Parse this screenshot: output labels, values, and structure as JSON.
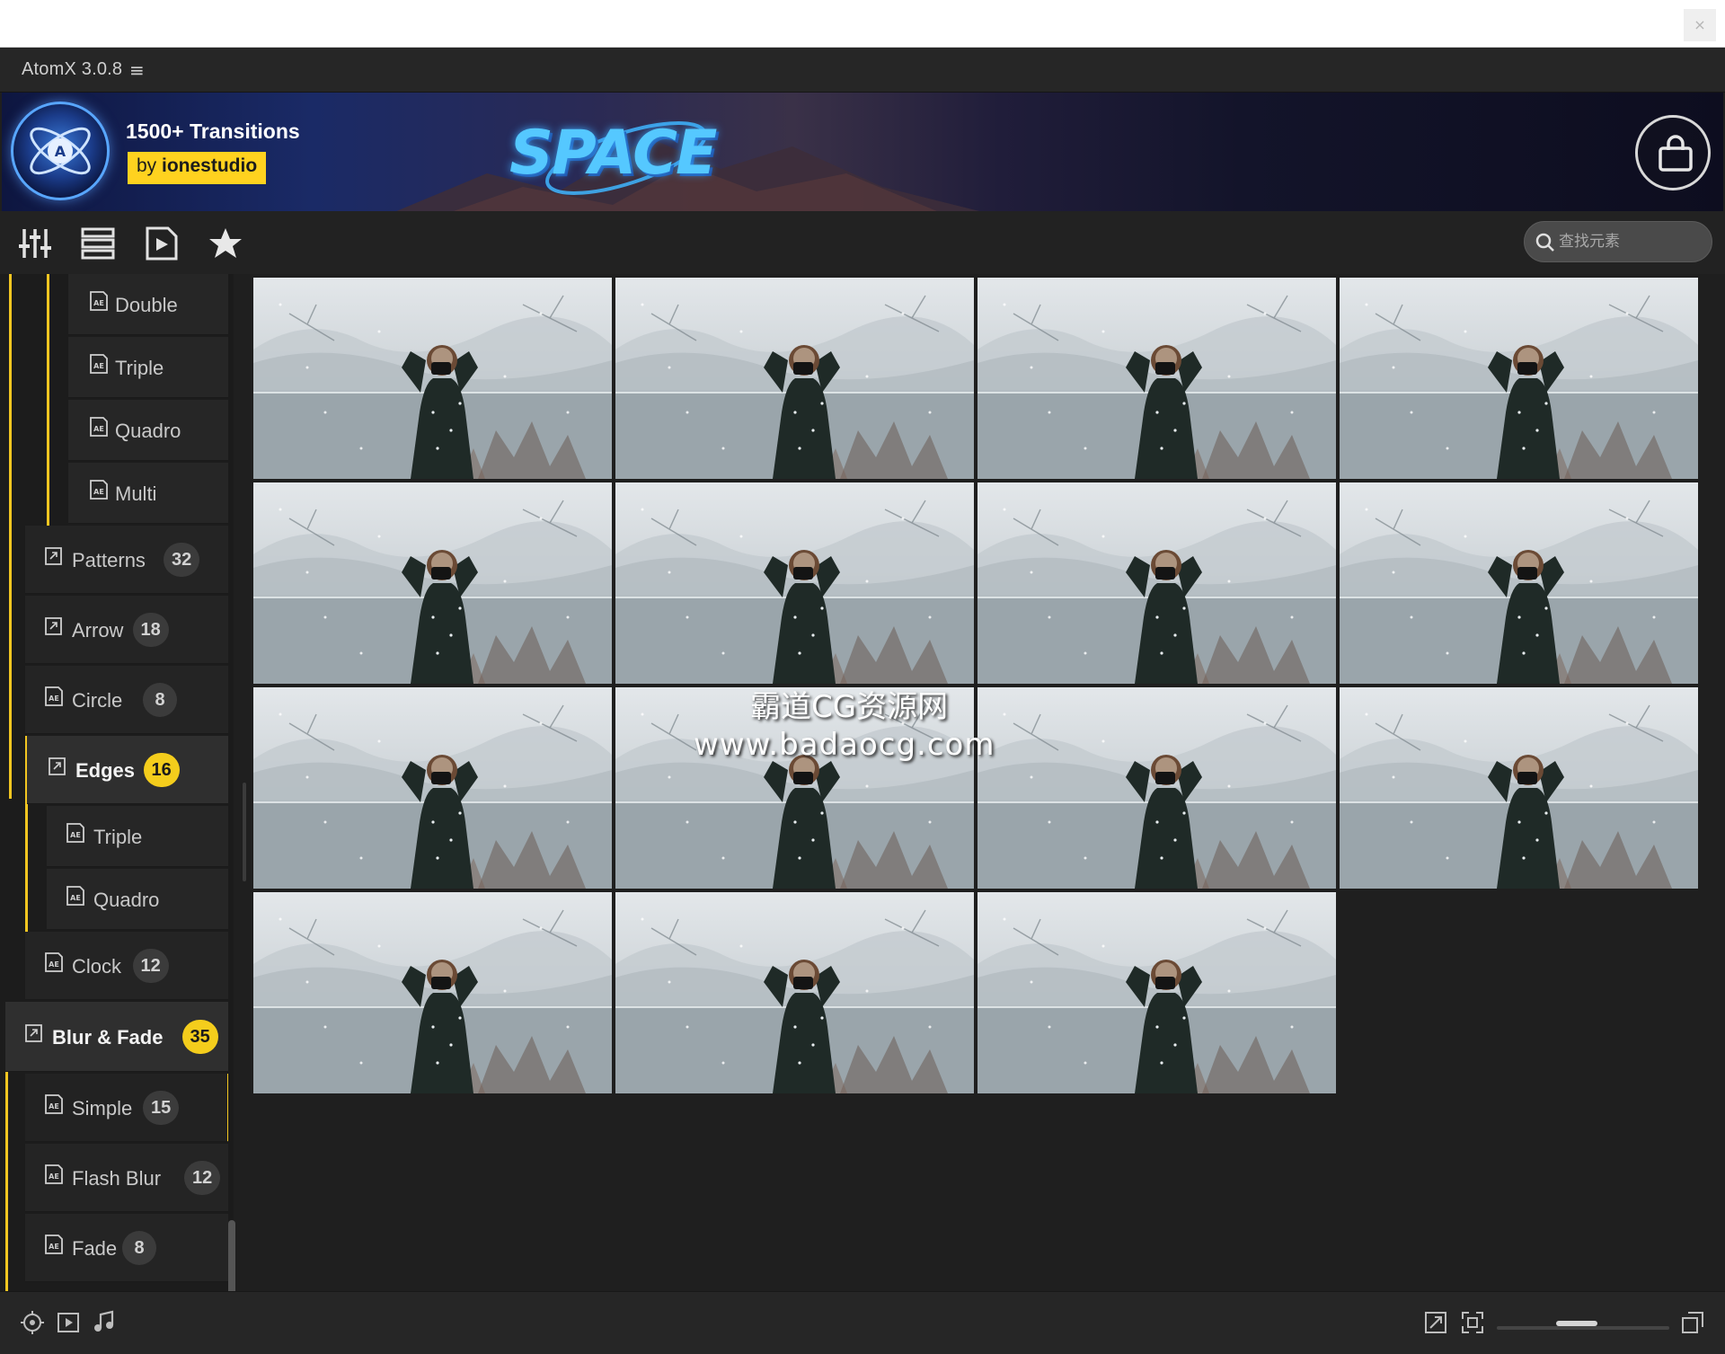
{
  "window": {
    "close_label": "×"
  },
  "app": {
    "title": "AtomX 3.0.8",
    "menu_glyph": "≡"
  },
  "banner": {
    "headline": "1500+ Transitions",
    "by_prefix": "by ",
    "by_brand": "ionestudio",
    "promo_text": "SPACE"
  },
  "toolbar": {
    "icons": [
      "sliders-icon",
      "list-view-icon",
      "play-file-icon",
      "star-icon"
    ],
    "search": {
      "placeholder": "查找元素",
      "value": ""
    }
  },
  "sidebar": {
    "items": [
      {
        "label": "Double",
        "level": 3,
        "badge": ""
      },
      {
        "label": "Triple",
        "level": 3,
        "badge": ""
      },
      {
        "label": "Quadro",
        "level": 3,
        "badge": ""
      },
      {
        "label": "Multi",
        "level": 3,
        "badge": ""
      },
      {
        "label": "Patterns",
        "level": 2,
        "badge": "32"
      },
      {
        "label": "Arrow",
        "level": 2,
        "badge": "18"
      },
      {
        "label": "Circle",
        "level": 2,
        "badge": "8"
      },
      {
        "label": "Edges",
        "level": 2,
        "badge": "16",
        "expanded": true
      },
      {
        "label": "Triple",
        "level": 3,
        "badge": ""
      },
      {
        "label": "Quadro",
        "level": 3,
        "badge": ""
      },
      {
        "label": "Clock",
        "level": 2,
        "badge": "12"
      },
      {
        "label": "Blur & Fade",
        "level": 1,
        "badge": "35",
        "expanded": true
      },
      {
        "label": "Simple",
        "level": 2,
        "badge": "15",
        "selected": true
      },
      {
        "label": "Flash Blur",
        "level": 2,
        "badge": "12"
      },
      {
        "label": "Fade",
        "level": 2,
        "badge": "8"
      }
    ]
  },
  "grid": {
    "thumbnail_count": 15,
    "thumbnail_subject": "photographer in snow"
  },
  "watermark": {
    "line1": "霸道CG资源网",
    "line2": "www.badaocg.com"
  },
  "bottom_bar": {
    "left_icons": [
      "target-icon",
      "video-icon",
      "music-icon"
    ],
    "right_icons": [
      "expand-icon",
      "fit-icon",
      "fullscreen-icon"
    ],
    "zoom_level": 0.45
  },
  "colors": {
    "accent_yellow": "#f4cd1c",
    "panel_dark": "#1f1f1f",
    "badge_gray": "#3b3b3b"
  }
}
